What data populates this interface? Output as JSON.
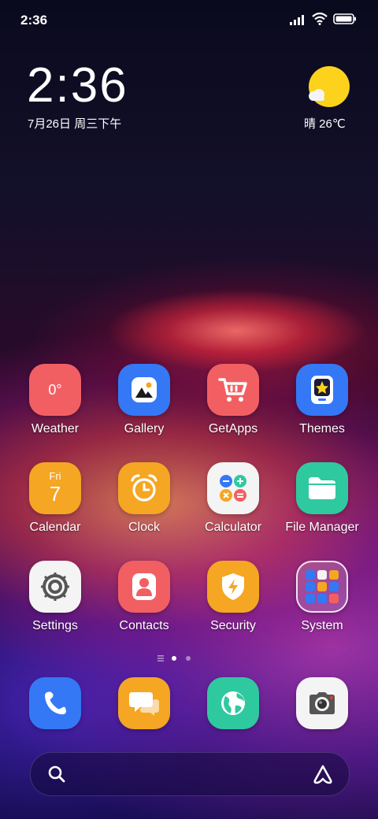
{
  "status_bar": {
    "time": "2:36"
  },
  "clock_widget": {
    "time": "2:36",
    "date": "7月26日 周三下午"
  },
  "weather_widget": {
    "text": "晴 26℃"
  },
  "apps": [
    {
      "label": "Weather",
      "icon": "weather-icon",
      "value": "0°",
      "color": "#f25f63"
    },
    {
      "label": "Gallery",
      "icon": "gallery-icon",
      "color": "#3478f6"
    },
    {
      "label": "GetApps",
      "icon": "cart-icon",
      "color": "#f25f63"
    },
    {
      "label": "Themes",
      "icon": "themes-icon",
      "color": "#3478f6"
    },
    {
      "label": "Calendar",
      "icon": "calendar-icon",
      "day": "Fri",
      "date": "7",
      "color": "#f5a623"
    },
    {
      "label": "Clock",
      "icon": "alarm-clock-icon",
      "color": "#f5a623"
    },
    {
      "label": "Calculator",
      "icon": "calculator-icon",
      "color": "#f4f4f4"
    },
    {
      "label": "File Manager",
      "icon": "folder-icon",
      "color": "#2fc9a0"
    },
    {
      "label": "Settings",
      "icon": "gear-icon",
      "color": "#f4f4f4"
    },
    {
      "label": "Contacts",
      "icon": "contacts-icon",
      "color": "#f25f63"
    },
    {
      "label": "Security",
      "icon": "shield-icon",
      "color": "#f5a623"
    },
    {
      "label": "System",
      "icon": "folder-grid-icon",
      "color": "#ffffff"
    }
  ],
  "dock": [
    {
      "icon": "phone-icon",
      "color": "#3478f6"
    },
    {
      "icon": "messages-icon",
      "color": "#f5a623"
    },
    {
      "icon": "browser-icon",
      "color": "#2fc9a0"
    },
    {
      "icon": "camera-icon",
      "color": "#f4f4f4"
    }
  ],
  "page_indicator": {
    "pages": 2,
    "current": 1
  }
}
